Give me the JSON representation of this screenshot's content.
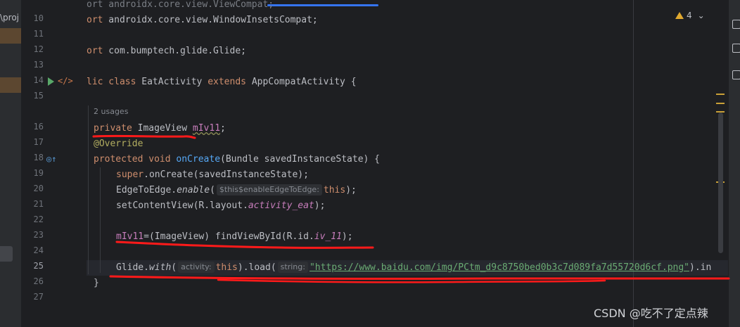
{
  "sidebar": {
    "project_label": "\\proj"
  },
  "gutter": {
    "line_numbers": [
      "10",
      "11",
      "12",
      "13",
      "14",
      "15",
      "16",
      "17",
      "18",
      "19",
      "20",
      "21",
      "22",
      "23",
      "24",
      "25",
      "26",
      "27"
    ],
    "current_line": "25"
  },
  "inspection": {
    "warning_count": "4"
  },
  "editor": {
    "line10": {
      "kw": "ort",
      "rest": " androidx.core.view.WindowInsetsCompat;"
    },
    "line12": {
      "kw": "ort",
      "rest": " com.bumptech.glide.Glide;"
    },
    "line14": {
      "kw1": "lic class",
      "cls": " EatActivity ",
      "kw2": "extends",
      "rest": " AppCompatActivity {"
    },
    "usages": "2 usages",
    "line16": {
      "kw": "private",
      "type": " ImageView ",
      "field": "mIv11",
      "end": ";"
    },
    "line17": {
      "ann": "@Override"
    },
    "line18": {
      "kw": "protected void ",
      "fn": "onCreate",
      "rest": "(Bundle savedInstanceState) {"
    },
    "line19": {
      "kw": "super",
      "rest": ".onCreate(savedInstanceState);"
    },
    "line20": {
      "pre": "EdgeToEdge.",
      "method": "enable",
      "open": "(",
      "hint": "$this$enableEdgeToEdge:",
      "kw": "this",
      "end": ");"
    },
    "line21": {
      "pre": "setContentView(R.layout.",
      "field": "activity_eat",
      "end": ");"
    },
    "line23": {
      "field": "mIv11",
      "mid": "=(ImageView) findViewById(R.id.",
      "id": "iv_11",
      "end": ");"
    },
    "line25": {
      "pre": "Glide.",
      "method": "with",
      "open": "(",
      "hint1": "activity:",
      "kw": "this",
      "mid": ").load(",
      "hint2": "string:",
      "str": "\"https://www.baidu.com/img/PCtm_d9c8750bed0b3c7d089fa7d55720d6cf.png\"",
      "end": ").in"
    },
    "line26": {
      "text": "}"
    }
  },
  "watermark": "CSDN @吃不了定点辣",
  "colors": {
    "background": "#1e1f22",
    "keyword": "#cf8e6d",
    "field": "#c77dbb",
    "function": "#56a8f5",
    "string": "#6aab73",
    "annotation": "#b3ae60",
    "highlight_pen": "#ff1a1a"
  }
}
